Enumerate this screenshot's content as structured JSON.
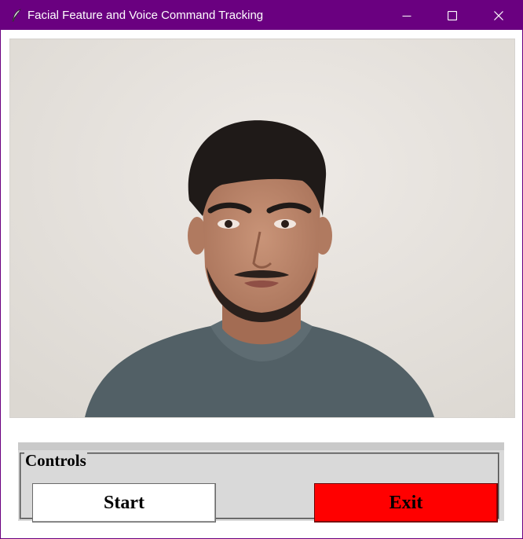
{
  "window": {
    "title": "Facial Feature and Voice Command Tracking",
    "icon": "feather-icon",
    "controls": [
      "minimize-icon",
      "maximize-icon",
      "close-icon"
    ],
    "title_bar_color": "#6a0080"
  },
  "video": {
    "description_icon": "camera-feed"
  },
  "controls": {
    "legend": "Controls",
    "start_label": "Start",
    "exit_label": "Exit",
    "start_color": "#ffffff",
    "exit_color": "#ff0000"
  }
}
